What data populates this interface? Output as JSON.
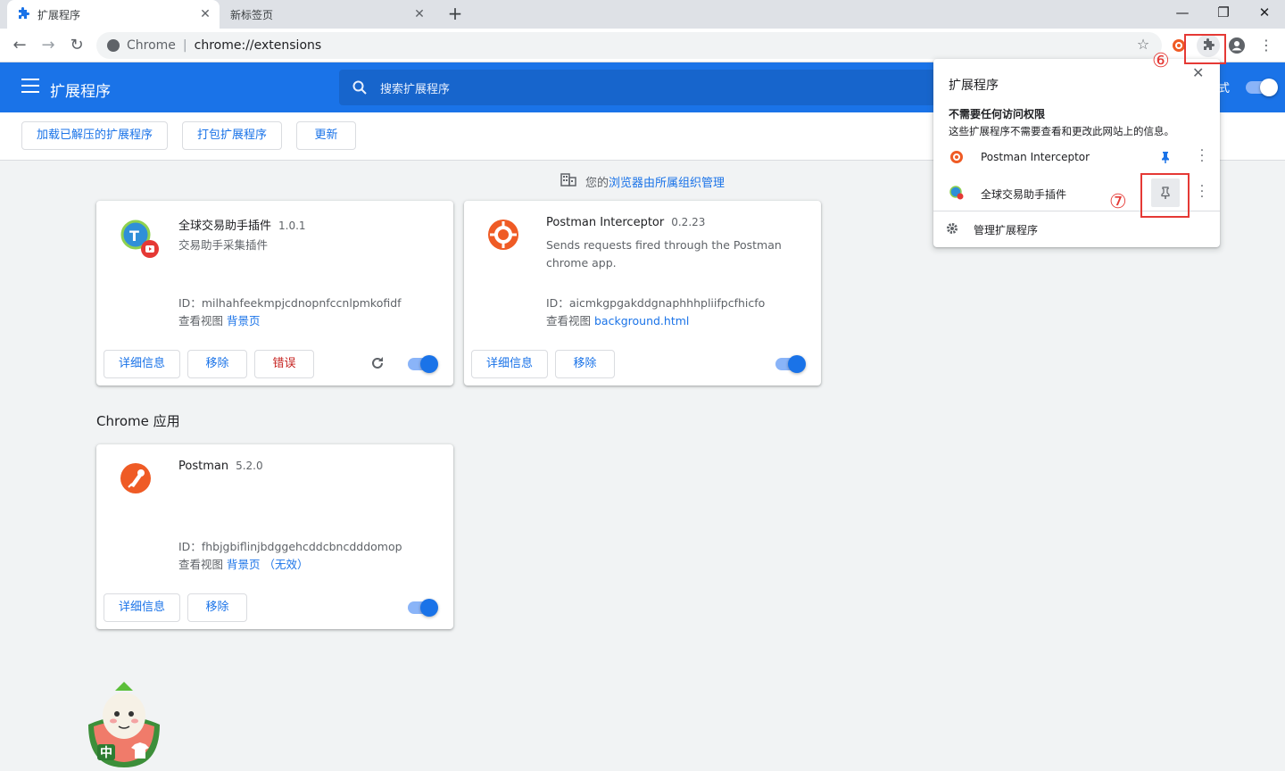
{
  "tabs": [
    {
      "label": "扩展程序",
      "active": true
    },
    {
      "label": "新标签页",
      "active": false
    }
  ],
  "omnibox": {
    "host": "Chrome",
    "separator": "|",
    "url": "chrome://extensions"
  },
  "header": {
    "title": "扩展程序",
    "search_placeholder": "搜索扩展程序",
    "devmode_label": "式"
  },
  "actions": {
    "load_unpacked": "加载已解压的扩展程序",
    "pack": "打包扩展程序",
    "update": "更新"
  },
  "managed": {
    "prefix": "您的",
    "link": "浏览器由所属组织管理"
  },
  "cards": [
    {
      "name": "全球交易助手插件",
      "version": "1.0.1",
      "desc": "交易助手采集插件",
      "id_label": "ID：",
      "id": "milhahfeekmpjcdnopnfccnlpmkofidf",
      "views_label": "查看视图",
      "view_link": "背景页",
      "view_extra": "",
      "details": "详细信息",
      "remove": "移除",
      "errors": "错误"
    },
    {
      "name": "Postman Interceptor",
      "version": "0.2.23",
      "desc": "Sends requests fired through the Postman chrome app.",
      "id_label": "ID：",
      "id": "aicmkgpgakddgnaphhhpliifpcfhicfo",
      "views_label": "查看视图",
      "view_link": "background.html",
      "view_extra": "",
      "details": "详细信息",
      "remove": "移除"
    }
  ],
  "apps_section": {
    "title": "Chrome 应用"
  },
  "apps": [
    {
      "name": "Postman",
      "version": "5.2.0",
      "id_label": "ID：",
      "id": "fhbjgbiflinjbdggehcddcbncdddomop",
      "views_label": "查看视图",
      "view_link": "背景页",
      "view_extra": "（无效）",
      "details": "详细信息",
      "remove": "移除"
    }
  ],
  "popup": {
    "title": "扩展程序",
    "subtitle": "不需要任何访问权限",
    "desc": "这些扩展程序不需要查看和更改此网站上的信息。",
    "items": [
      {
        "name": "Postman Interceptor",
        "pinned": true
      },
      {
        "name": "全球交易助手插件",
        "pinned": false
      }
    ],
    "manage": "管理扩展程序"
  },
  "annotations": {
    "six": "⑥",
    "seven": "⑦"
  },
  "mascot_text": "中",
  "colors": {
    "accent": "#1a73e8",
    "header": "#1a73e8",
    "error": "#c5221f",
    "highlight": "#e53935"
  }
}
